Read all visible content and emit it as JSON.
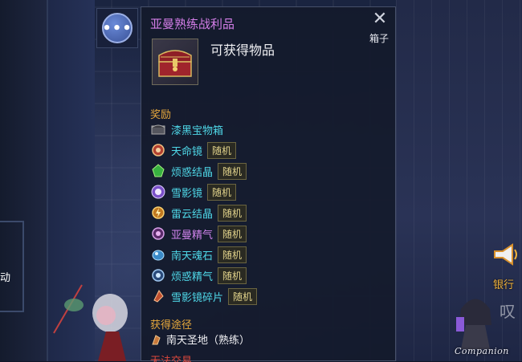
{
  "background": {
    "bank_label": "银行",
    "companion_label": "Companion",
    "left_partial_text": "动"
  },
  "more_button": {
    "label": "•••"
  },
  "tooltip": {
    "title": "亚曼熟练战利品",
    "type": "箱子",
    "obtain_text": "可获得物品",
    "close_icon": "close-icon",
    "rewards_header": "奖励",
    "rewards": [
      {
        "name": "漆黑宝物箱",
        "badge": "",
        "color": "#4fd8e8",
        "icon": "black-chest-icon"
      },
      {
        "name": "天命镜",
        "badge": "随机",
        "color": "#4fd8e8",
        "icon": "mirror-icon"
      },
      {
        "name": "烦惑结晶",
        "badge": "随机",
        "color": "#4fd8e8",
        "icon": "green-crystal-icon"
      },
      {
        "name": "雪影镜",
        "badge": "随机",
        "color": "#4fd8e8",
        "icon": "snow-mirror-icon"
      },
      {
        "name": "雷云结晶",
        "badge": "随机",
        "color": "#4fd8e8",
        "icon": "thunder-crystal-icon"
      },
      {
        "name": "亚曼精气",
        "badge": "随机",
        "color": "#d084ec",
        "icon": "essence-icon"
      },
      {
        "name": "南天魂石",
        "badge": "随机",
        "color": "#4fd8e8",
        "icon": "soul-stone-icon"
      },
      {
        "name": "烦惑精气",
        "badge": "随机",
        "color": "#4fd8e8",
        "icon": "essence-icon"
      },
      {
        "name": "雪影镜碎片",
        "badge": "随机",
        "color": "#4fd8e8",
        "icon": "mirror-shard-icon"
      }
    ],
    "source_header": "获得途径",
    "source": "南天圣地（熟练）",
    "untradable": "无法交易"
  }
}
